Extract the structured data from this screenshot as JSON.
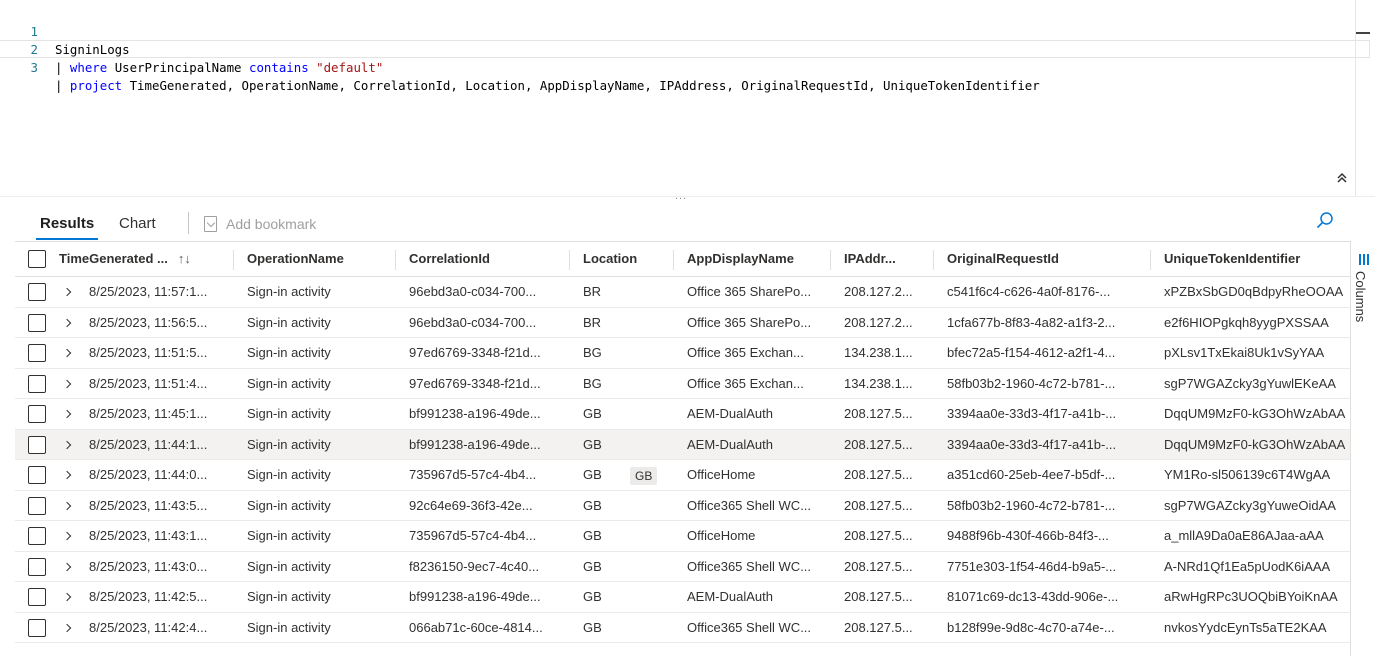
{
  "editor": {
    "lines": [
      {
        "num": "1",
        "text": "SigninLogs"
      },
      {
        "num": "2",
        "pipe": "| ",
        "kw1": "where",
        "mid": " UserPrincipalName ",
        "kw2": "contains",
        "sp": " ",
        "str": "\"default\""
      },
      {
        "num": "3",
        "pipe": "| ",
        "kw1": "project",
        "rest": " TimeGenerated, OperationName, CorrelationId, Location, AppDisplayName, IPAddress, OriginalRequestId, UniqueTokenIdentifier"
      }
    ],
    "collapse_icon": "double-chevron-up-icon",
    "splitter_grip": "..."
  },
  "toolbar": {
    "tabs": [
      {
        "label": "Results",
        "selected": true
      },
      {
        "label": "Chart",
        "selected": false
      }
    ],
    "bookmark_label": "Add bookmark",
    "bookmark_icon": "bookmark-icon",
    "search_icon": "search-icon"
  },
  "grid": {
    "columns": [
      "TimeGenerated ...",
      "OperationName",
      "CorrelationId",
      "Location",
      "AppDisplayName",
      "IPAddr...",
      "OriginalRequestId",
      "UniqueTokenIdentifier"
    ],
    "sort_icon": "↑↓",
    "rows": [
      [
        "8/25/2023, 11:57:1...",
        "Sign-in activity",
        "96ebd3a0-c034-700...",
        "BR",
        "Office 365 SharePo...",
        "208.127.2...",
        "c541f6c4-c626-4a0f-8176-...",
        "xPZBxSbGD0qBdpyRheOOAA"
      ],
      [
        "8/25/2023, 11:56:5...",
        "Sign-in activity",
        "96ebd3a0-c034-700...",
        "BR",
        "Office 365 SharePo...",
        "208.127.2...",
        "1cfa677b-8f83-4a82-a1f3-2...",
        "e2f6HIOPgkqh8yygPXSSAA"
      ],
      [
        "8/25/2023, 11:51:5...",
        "Sign-in activity",
        "97ed6769-3348-f21d...",
        "BG",
        "Office 365 Exchan...",
        "134.238.1...",
        "bfec72a5-f154-4612-a2f1-4...",
        "pXLsv1TxEkai8Uk1vSyYAA"
      ],
      [
        "8/25/2023, 11:51:4...",
        "Sign-in activity",
        "97ed6769-3348-f21d...",
        "BG",
        "Office 365 Exchan...",
        "134.238.1...",
        "58fb03b2-1960-4c72-b781-...",
        "sgP7WGAZcky3gYuwlEKeAA"
      ],
      [
        "8/25/2023, 11:45:1...",
        "Sign-in activity",
        "bf991238-a196-49de...",
        "GB",
        "AEM-DualAuth",
        "208.127.5...",
        "3394aa0e-33d3-4f17-a41b-...",
        "DqqUM9MzF0-kG3OhWzAbAA"
      ],
      [
        "8/25/2023, 11:44:1...",
        "Sign-in activity",
        "bf991238-a196-49de...",
        "GB",
        "AEM-DualAuth",
        "208.127.5...",
        "3394aa0e-33d3-4f17-a41b-...",
        "DqqUM9MzF0-kG3OhWzAbAA"
      ],
      [
        "8/25/2023, 11:44:0...",
        "Sign-in activity",
        "735967d5-57c4-4b4...",
        "GB",
        "OfficeHome",
        "208.127.5...",
        "a351cd60-25eb-4ee7-b5df-...",
        "YM1Ro-sl506139c6T4WgAA"
      ],
      [
        "8/25/2023, 11:43:5...",
        "Sign-in activity",
        "92c64e69-36f3-42e...",
        "GB",
        "Office365 Shell WC...",
        "208.127.5...",
        "58fb03b2-1960-4c72-b781-...",
        "sgP7WGAZcky3gYuweOidAA"
      ],
      [
        "8/25/2023, 11:43:1...",
        "Sign-in activity",
        "735967d5-57c4-4b4...",
        "GB",
        "OfficeHome",
        "208.127.5...",
        "9488f96b-430f-466b-84f3-...",
        "a_mllA9Da0aE86AJaa-aAA"
      ],
      [
        "8/25/2023, 11:43:0...",
        "Sign-in activity",
        "f8236150-9ec7-4c40...",
        "GB",
        "Office365 Shell WC...",
        "208.127.5...",
        "7751e303-1f54-46d4-b9a5-...",
        "A-NRd1Qf1Ea5pUodK6iAAA"
      ],
      [
        "8/25/2023, 11:42:5...",
        "Sign-in activity",
        "bf991238-a196-49de...",
        "GB",
        "AEM-DualAuth",
        "208.127.5...",
        "81071c69-dc13-43dd-906e-...",
        "aRwHgRPc3UOQbiBYoiKnAA"
      ],
      [
        "8/25/2023, 11:42:4...",
        "Sign-in activity",
        "066ab71c-60ce-4814...",
        "GB",
        "Office365 Shell WC...",
        "208.127.5...",
        "b128f99e-9d8c-4c70-a74e-...",
        "nvkosYydcEynTs5aTE2KAA"
      ]
    ],
    "highlighted_row": 5,
    "hover_tooltip": {
      "row": 6,
      "text": "GB"
    }
  },
  "side_panel": {
    "label": "Columns",
    "icon": "columns-icon"
  },
  "colors": {
    "accent": "#0078d4",
    "keyword": "#0000ff",
    "string": "#a31515",
    "line_number": "#237893"
  }
}
